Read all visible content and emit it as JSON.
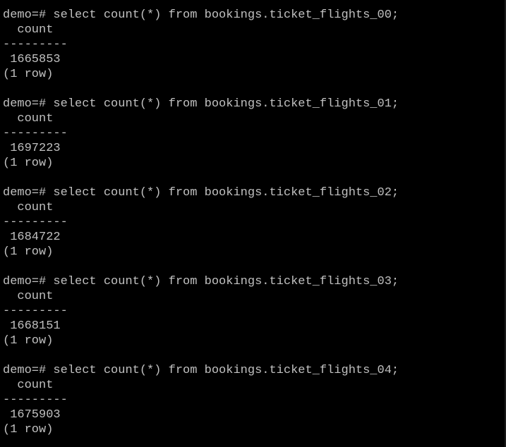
{
  "terminal": {
    "artifact": "\"",
    "blocks": [
      {
        "prompt": "demo=#",
        "command": "select count(*) from bookings.ticket_flights_00;",
        "header": "count",
        "separator": "---------",
        "value": "1665853",
        "footer": "(1 row)"
      },
      {
        "prompt": "demo=#",
        "command": "select count(*) from bookings.ticket_flights_01;",
        "header": "count",
        "separator": "---------",
        "value": "1697223",
        "footer": "(1 row)"
      },
      {
        "prompt": "demo=#",
        "command": "select count(*) from bookings.ticket_flights_02;",
        "header": "count",
        "separator": "---------",
        "value": "1684722",
        "footer": "(1 row)"
      },
      {
        "prompt": "demo=#",
        "command": "select count(*) from bookings.ticket_flights_03;",
        "header": "count",
        "separator": "---------",
        "value": "1668151",
        "footer": "(1 row)"
      },
      {
        "prompt": "demo=#",
        "command": "select count(*) from bookings.ticket_flights_04;",
        "header": "count",
        "separator": "---------",
        "value": "1675903",
        "footer": "(1 row)"
      }
    ]
  }
}
